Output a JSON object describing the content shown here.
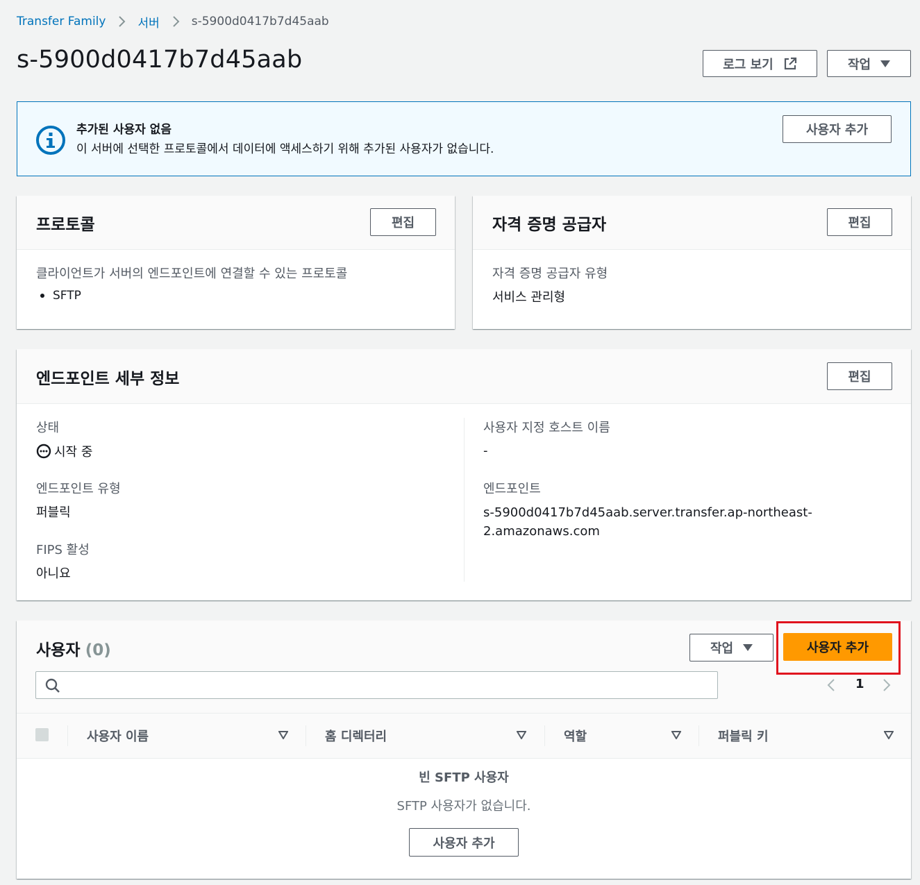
{
  "breadcrumb": {
    "items": [
      "Transfer Family",
      "서버"
    ],
    "current": "s-5900d0417b7d45aab"
  },
  "page": {
    "title": "s-5900d0417b7d45aab",
    "logs_button": "로그 보기",
    "actions_button": "작업"
  },
  "flash": {
    "title": "추가된 사용자 없음",
    "message": "이 서버에 선택한 프로토콜에서 데이터에 액세스하기 위해 추가된 사용자가 없습니다.",
    "button": "사용자 추가"
  },
  "protocols": {
    "title": "프로토콜",
    "edit": "편집",
    "label": "클라이언트가 서버의 엔드포인트에 연결할 수 있는 프로토콜",
    "items": [
      "SFTP"
    ]
  },
  "identity": {
    "title": "자격 증명 공급자",
    "edit": "편집",
    "label": "자격 증명 공급자 유형",
    "value": "서비스 관리형"
  },
  "endpoint": {
    "title": "엔드포인트 세부 정보",
    "edit": "편집",
    "state_label": "상태",
    "state_value": "시작 중",
    "type_label": "엔드포인트 유형",
    "type_value": "퍼블릭",
    "fips_label": "FIPS 활성",
    "fips_value": "아니요",
    "hostname_label": "사용자 지정 호스트 이름",
    "hostname_value": "-",
    "endpoint_label": "엔드포인트",
    "endpoint_value_line1": "s-5900d0417b7d45aab.server.transfer.ap-northeast-",
    "endpoint_value_line2": "2.amazonaws.com"
  },
  "users": {
    "title": "사용자",
    "count": "(0)",
    "actions_button": "작업",
    "add_button": "사용자 추가",
    "search_placeholder": "",
    "page_number": "1",
    "columns": [
      "사용자 이름",
      "홈 디렉터리",
      "역할",
      "퍼블릭 키"
    ],
    "empty_title": "빈 SFTP 사용자",
    "empty_message": "SFTP 사용자가 없습니다.",
    "empty_button": "사용자 추가"
  },
  "colors": {
    "accent": "#0073bb",
    "primary": "#ff9900",
    "highlight": "#e0131e"
  }
}
